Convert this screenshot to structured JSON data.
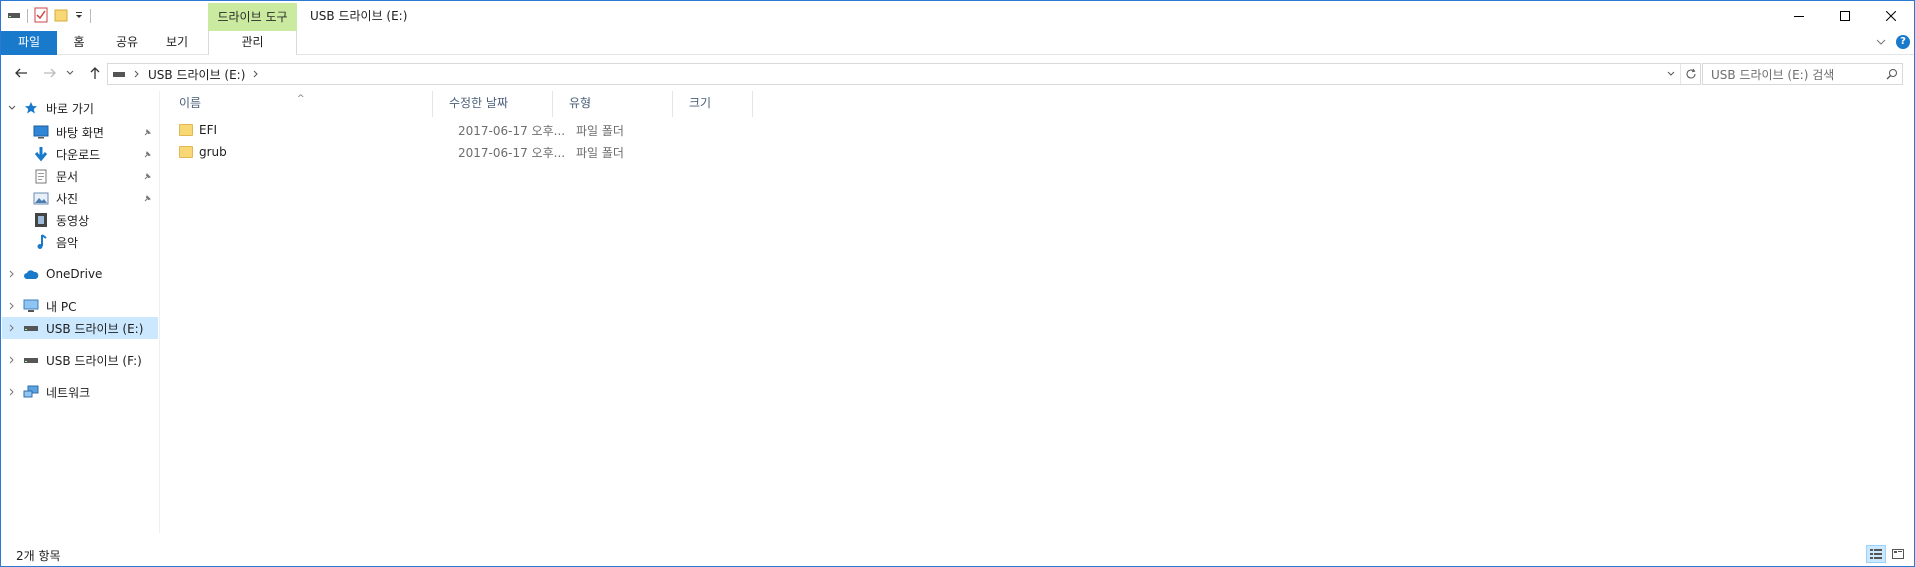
{
  "window": {
    "title": "USB 드라이브 (E:)",
    "context_tab_header": "드라이브 도구"
  },
  "ribbon": {
    "tabs": [
      {
        "label": "파일"
      },
      {
        "label": "홈"
      },
      {
        "label": "공유"
      },
      {
        "label": "보기"
      },
      {
        "label": "관리"
      }
    ]
  },
  "address": {
    "crumb": "USB 드라이브 (E:)"
  },
  "search": {
    "placeholder": "USB 드라이브 (E:) 검색"
  },
  "nav": {
    "quick_access": "바로 가기",
    "quick_items": [
      {
        "label": "바탕 화면"
      },
      {
        "label": "다운로드"
      },
      {
        "label": "문서"
      },
      {
        "label": "사진"
      },
      {
        "label": "동영상"
      },
      {
        "label": "음악"
      }
    ],
    "onedrive": "OneDrive",
    "this_pc": "내 PC",
    "usb_e": "USB 드라이브 (E:)",
    "usb_f": "USB 드라이브 (F:)",
    "network": "네트워크"
  },
  "columns": {
    "name": "이름",
    "date": "수정한 날짜",
    "type": "유형",
    "size": "크기"
  },
  "files": [
    {
      "name": "EFI",
      "date": "2017-06-17 오후...",
      "type": "파일 폴더"
    },
    {
      "name": "grub",
      "date": "2017-06-17 오후...",
      "type": "파일 폴더"
    }
  ],
  "status": {
    "item_count": "2개 항목"
  },
  "colors": {
    "accent": "#1979ca",
    "selection": "#cce8ff",
    "context_tab": "#c9ea9f",
    "folder": "#f8d775"
  }
}
